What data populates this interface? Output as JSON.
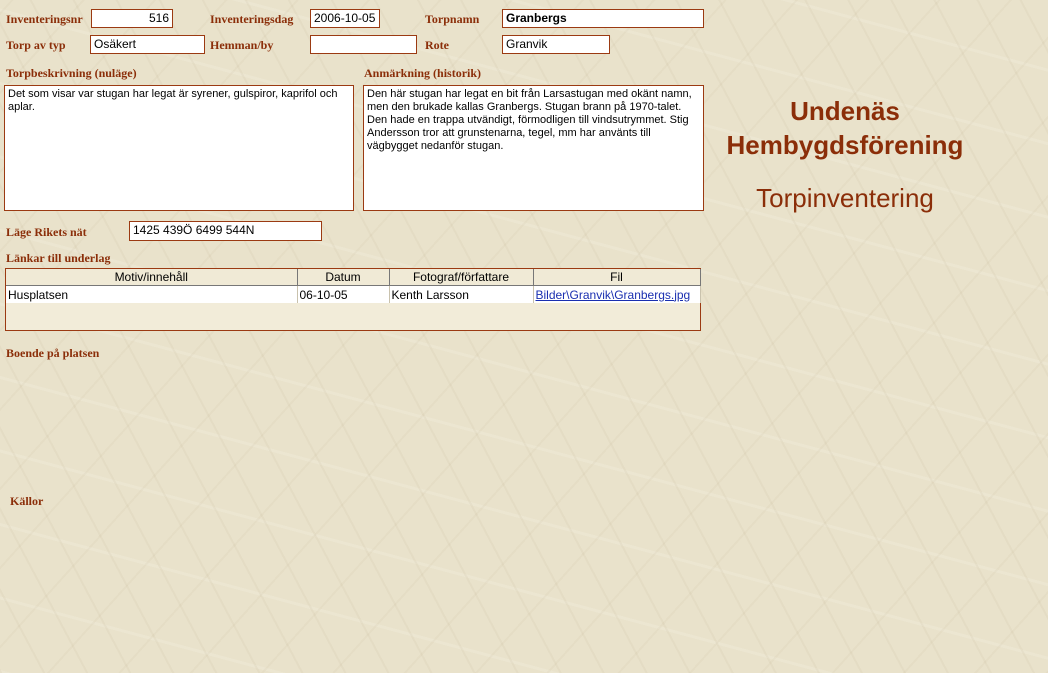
{
  "header": {
    "inventeringsnr_label": "Inventeringsnr",
    "inventeringsnr_value": "516",
    "inventeringsdag_label": "Inventeringsdag",
    "inventeringsdag_value": "2006-10-05",
    "torpnamn_label": "Torpnamn",
    "torpnamn_value": "Granbergs",
    "torp_av_typ_label": "Torp av typ",
    "torp_av_typ_value": "Osäkert",
    "hemman_by_label": "Hemman/by",
    "hemman_by_value": "",
    "rote_label": "Rote",
    "rote_value": "Granvik"
  },
  "beskrivning": {
    "label": "Torpbeskrivning (nuläge)",
    "text": "Det som visar var stugan har legat är syrener, gulspiror, kaprifol och aplar."
  },
  "anmarkning": {
    "label": "Anmärkning (historik)",
    "text": "Den här stugan har legat en bit från Larsastugan med okänt namn, men den brukade kallas Granbergs. Stugan brann på 1970-talet. Den hade en trappa utvändigt, förmodligen till vindsutrymmet. Stig Andersson tror att grunstenarna, tegel, mm har använts till vägbygget nedanför stugan."
  },
  "lage": {
    "label": "Läge Rikets nät",
    "value": "1425 439Ö  6499 544N"
  },
  "lankar": {
    "label": "Länkar till underlag",
    "columns": [
      "Motiv/innehåll",
      "Datum",
      "Fotograf/författare",
      "Fil"
    ],
    "rows": [
      [
        "Husplatsen",
        "06-10-05",
        "Kenth Larsson",
        "Bilder\\Granvik\\Granbergs.jpg"
      ]
    ]
  },
  "boende": {
    "label": "Boende på platsen"
  },
  "kallor": {
    "label": "Källor"
  },
  "brand": {
    "title_line1": "Undenäs",
    "title_line2": "Hembygdsförening",
    "subtitle": "Torpinventering"
  },
  "colors": {
    "label_color": "#8b2e09",
    "border_color": "#9b3a12",
    "background": "#e9e2cb",
    "link_color": "#1a2fb0"
  }
}
